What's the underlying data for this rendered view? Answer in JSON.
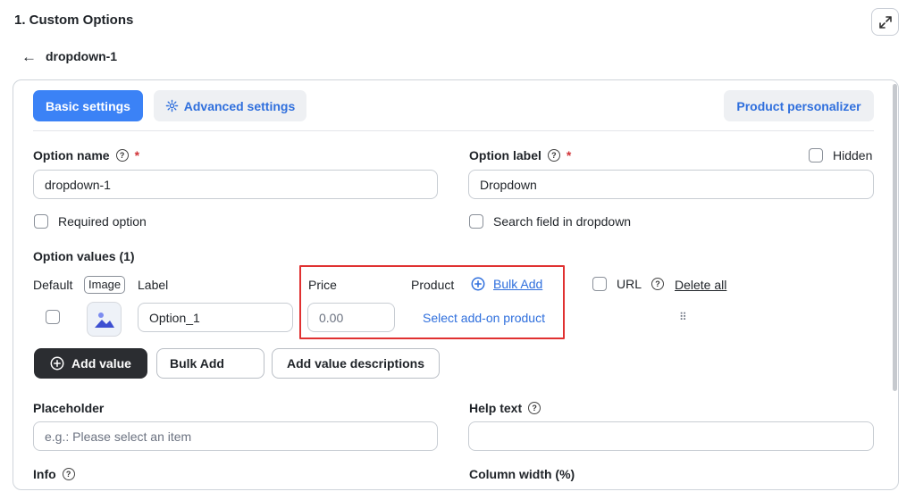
{
  "header": {
    "title": "1. Custom Options",
    "back_label": "dropdown-1"
  },
  "tabs": {
    "basic": "Basic settings",
    "advanced": "Advanced settings",
    "personalizer": "Product personalizer"
  },
  "option_name": {
    "label": "Option name",
    "required_mark": "*",
    "value": "dropdown-1"
  },
  "option_label": {
    "label": "Option label",
    "required_mark": "*",
    "value": "Dropdown",
    "hidden_label": "Hidden"
  },
  "checks": {
    "required_option": "Required option",
    "search_field": "Search field in dropdown"
  },
  "option_values": {
    "title": "Option values (1)",
    "columns": {
      "default": "Default",
      "image": "Image",
      "label": "Label",
      "price": "Price",
      "product": "Product",
      "bulk_add_link": "Bulk Add",
      "url": "URL",
      "delete_all": "Delete all"
    },
    "rows": [
      {
        "label": "Option_1",
        "price_placeholder": "0.00",
        "product_link": "Select add-on product"
      }
    ]
  },
  "actions": {
    "add_value": "Add value",
    "bulk_add": "Bulk Add",
    "add_descriptions": "Add value descriptions"
  },
  "placeholder": {
    "label": "Placeholder",
    "input_placeholder": "e.g.: Please select an item"
  },
  "help_text": {
    "label": "Help text",
    "value": ""
  },
  "info": {
    "label": "Info"
  },
  "column_width": {
    "label": "Column width (%)"
  },
  "colors": {
    "primary": "#3b82f6",
    "link": "#2f6fdd",
    "dark_button": "#2b2d31",
    "highlight": "#e03131",
    "required": "#d13438"
  }
}
